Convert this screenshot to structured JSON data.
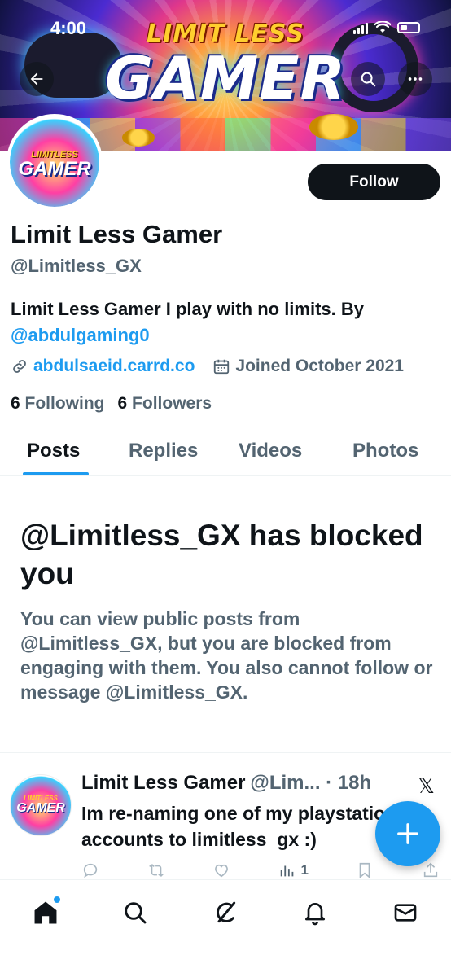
{
  "status_bar": {
    "time": "4:00"
  },
  "banner": {
    "title_top": "LIMIT LESS",
    "title_main": "GAMER"
  },
  "avatar": {
    "logo_top": "LIMITLESS",
    "logo_main": "GAMER"
  },
  "profile": {
    "display_name": "Limit Less Gamer",
    "handle": "@Limitless_GX",
    "bio_text": "Limit Less Gamer I play with no limits. By",
    "bio_mention": "@abdulgaming0",
    "website": "abdulsaeid.carrd.co",
    "joined": "Joined October 2021",
    "following_count": "6",
    "following_label": "Following",
    "followers_count": "6",
    "followers_label": "Followers"
  },
  "actions": {
    "follow_label": "Follow"
  },
  "tabs": [
    {
      "label": "Posts",
      "active": true
    },
    {
      "label": "Replies",
      "active": false
    },
    {
      "label": "Videos",
      "active": false
    },
    {
      "label": "Photos",
      "active": false
    }
  ],
  "blocked": {
    "title": "@Limitless_GX has blocked you",
    "message": "You can view public posts from @Limitless_GX, but you are blocked from engaging with them. You also cannot follow or message @Limitless_GX."
  },
  "post": {
    "author_name": "Limit Less Gamer",
    "author_handle": "@Lim... · 18h",
    "text": "Im re-naming one of my playstation accounts to limitless_gx :)",
    "views_count": "1",
    "icons": [
      "reply-icon",
      "repost-icon",
      "like-icon",
      "views-icon",
      "bookmark-icon",
      "share-icon"
    ]
  },
  "bottom_nav": [
    "home-icon",
    "search-icon",
    "grok-icon",
    "notifications-icon",
    "messages-icon"
  ],
  "colors": {
    "accent": "#1d9bf0",
    "text": "#0f1419",
    "secondary": "#536471"
  }
}
